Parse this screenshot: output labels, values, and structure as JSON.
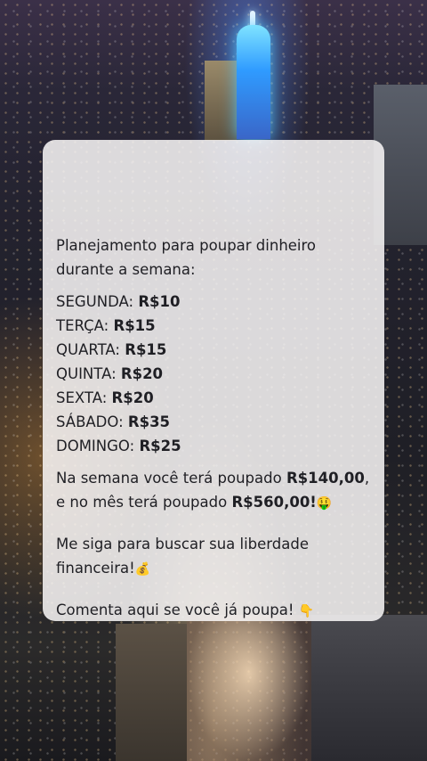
{
  "post": {
    "intro": "Planejamento para poupar dinheiro durante a semana:",
    "days": [
      {
        "day": "SEGUNDA:",
        "amount": "R$10"
      },
      {
        "day": "TERÇA:",
        "amount": "R$15"
      },
      {
        "day": "QUARTA:",
        "amount": "R$15"
      },
      {
        "day": "QUINTA:",
        "amount": "R$20"
      },
      {
        "day": "SEXTA:",
        "amount": "R$20"
      },
      {
        "day": "SÁBADO:",
        "amount": "R$35"
      },
      {
        "day": "DOMINGO:",
        "amount": "R$25"
      }
    ],
    "summary": {
      "part1": "Na semana você terá  poupado ",
      "week_total": "R$140,00",
      "part2": ", e no mês terá poupado ",
      "month_total": "R$560,00!",
      "emoji": "🤑"
    },
    "follow": {
      "text": "Me siga para buscar sua liberdade financeira!",
      "emoji": "💰"
    },
    "comment": {
      "text": "Comenta aqui se você já poupa! ",
      "emoji": "👇"
    }
  }
}
